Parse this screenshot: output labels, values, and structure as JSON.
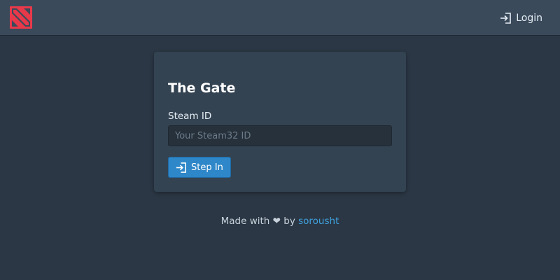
{
  "navbar": {
    "logo_icon": "dota-logo-icon",
    "login_icon": "sign-in-icon",
    "login_label": "Login"
  },
  "card": {
    "title": "The Gate",
    "steam_id_label": "Steam ID",
    "steam_id_value": "",
    "steam_id_placeholder": "Your Steam32 ID",
    "button_icon": "sign-in-icon",
    "button_label": "Step In"
  },
  "footer": {
    "prefix": "Made with",
    "heart": "❤",
    "by": "by",
    "author": "sorousht"
  },
  "colors": {
    "background": "#2b3744",
    "navbar": "#3a4a5b",
    "card": "#344352",
    "primary_button": "#2e87c8",
    "link": "#3fa3e0",
    "logo": "#e8394a"
  }
}
